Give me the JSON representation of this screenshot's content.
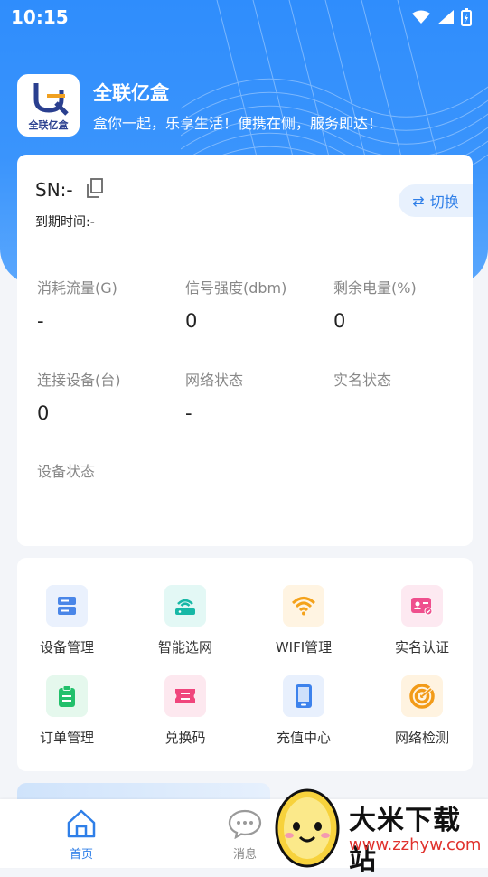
{
  "status_bar": {
    "time": "10:15"
  },
  "brand": {
    "logo_text": "全联亿盒",
    "name": "全联亿盒",
    "slogan": "盒你一起，乐享生活！便携在侧，服务即达！"
  },
  "device": {
    "sn": "SN:-",
    "expire": "到期时间:-",
    "switch_label": "切换",
    "stats": [
      {
        "label": "消耗流量(G)",
        "value": "-"
      },
      {
        "label": "信号强度(dbm)",
        "value": "0"
      },
      {
        "label": "剩余电量(%)",
        "value": "0"
      },
      {
        "label": "连接设备(台)",
        "value": "0"
      },
      {
        "label": "网络状态",
        "value": "-"
      },
      {
        "label": "实名状态",
        "value": ""
      },
      {
        "label": "设备状态",
        "value": ""
      }
    ]
  },
  "menu": {
    "items": [
      {
        "label": "设备管理",
        "icon": "device-manage-icon",
        "color": "#4a86e8",
        "bg": "#eaf1fd"
      },
      {
        "label": "智能选网",
        "icon": "router-icon",
        "color": "#17b8a6",
        "bg": "#e3f8f5"
      },
      {
        "label": "WIFI管理",
        "icon": "wifi-icon",
        "color": "#f4a21b",
        "bg": "#fff4e2"
      },
      {
        "label": "实名认证",
        "icon": "id-card-icon",
        "color": "#ef4f8d",
        "bg": "#fde9f1"
      },
      {
        "label": "订单管理",
        "icon": "clipboard-icon",
        "color": "#22c06b",
        "bg": "#e5f8ed"
      },
      {
        "label": "兑换码",
        "icon": "ticket-icon",
        "color": "#f0457c",
        "bg": "#fde8ef"
      },
      {
        "label": "充值中心",
        "icon": "phone-icon",
        "color": "#3d82ec",
        "bg": "#e8f0fd"
      },
      {
        "label": "网络检测",
        "icon": "radar-icon",
        "color": "#f29b19",
        "bg": "#fff3e0"
      }
    ]
  },
  "tabbar": {
    "home": "首页",
    "messages": "消息"
  },
  "watermark": {
    "title": "大米下载站",
    "url": "www.zzhyw.com"
  }
}
